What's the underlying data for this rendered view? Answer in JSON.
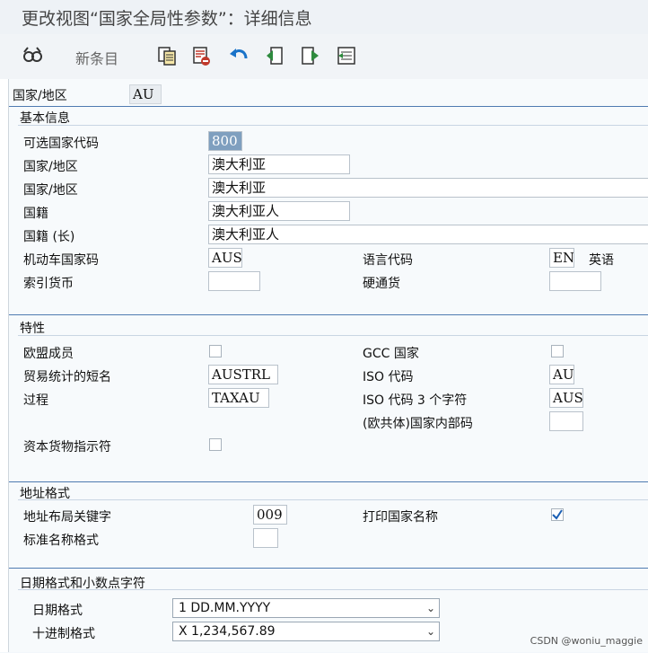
{
  "window": {
    "title": "更改视图“国家全局性参数”：详细信息"
  },
  "toolbar": {
    "new_entries_label": "新条目",
    "icons": [
      "glasses-icon",
      "copy-icon",
      "delete-icon",
      "undo-icon",
      "prev-entry-icon",
      "next-entry-icon",
      "select-all-icon"
    ]
  },
  "header": {
    "country_label": "国家/地区",
    "country_value": "AU"
  },
  "basic": {
    "section_title": "基本信息",
    "alt_code_label": "可选国家代码",
    "alt_code_value": "800",
    "country_label": "国家/地区",
    "country_value": "澳大利亚",
    "country_long_label": "国家/地区",
    "country_long_value": "澳大利亚",
    "nationality_label": "国籍",
    "nationality_value": "澳大利亚人",
    "nationality_long_label": "国籍 (长)",
    "nationality_long_value": "澳大利亚人",
    "vehicle_code_label": "机动车国家码",
    "vehicle_code_value": "AUS",
    "lang_code_label": "语言代码",
    "lang_code_value": "EN",
    "lang_name": "英语",
    "index_currency_label": "索引货币",
    "index_currency_value": "",
    "hard_currency_label": "硬通货",
    "hard_currency_value": ""
  },
  "properties": {
    "section_title": "特性",
    "eu_member_label": "欧盟成员",
    "eu_member_checked": false,
    "gcc_label": "GCC 国家",
    "gcc_checked": false,
    "trade_short_label": "贸易统计的短名",
    "trade_short_value": "AUSTRL",
    "iso_label": "ISO 代码",
    "iso_value": "AU",
    "procedure_label": "过程",
    "procedure_value": "TAXAU",
    "iso3_label": "ISO 代码 3 个字符",
    "iso3_value": "AUS",
    "eu_internal_label": "(欧共体)国家内部码",
    "eu_internal_value": "",
    "capital_goods_label": "资本货物指示符",
    "capital_goods_checked": false
  },
  "address": {
    "section_title": "地址格式",
    "layout_key_label": "地址布局关键字",
    "layout_key_value": "009",
    "print_country_label": "打印国家名称",
    "print_country_checked": true,
    "std_name_label": "标准名称格式",
    "std_name_value": ""
  },
  "date_format": {
    "section_title": "日期格式和小数点字符",
    "date_label": "日期格式",
    "date_value": "1 DD.MM.YYYY",
    "decimal_label": "十进制格式",
    "decimal_value": "X 1,234,567.89"
  },
  "watermark": "CSDN @woniu_maggie",
  "colors": {
    "accent": "#4f7bb1",
    "field_border": "#b9c2cb"
  }
}
